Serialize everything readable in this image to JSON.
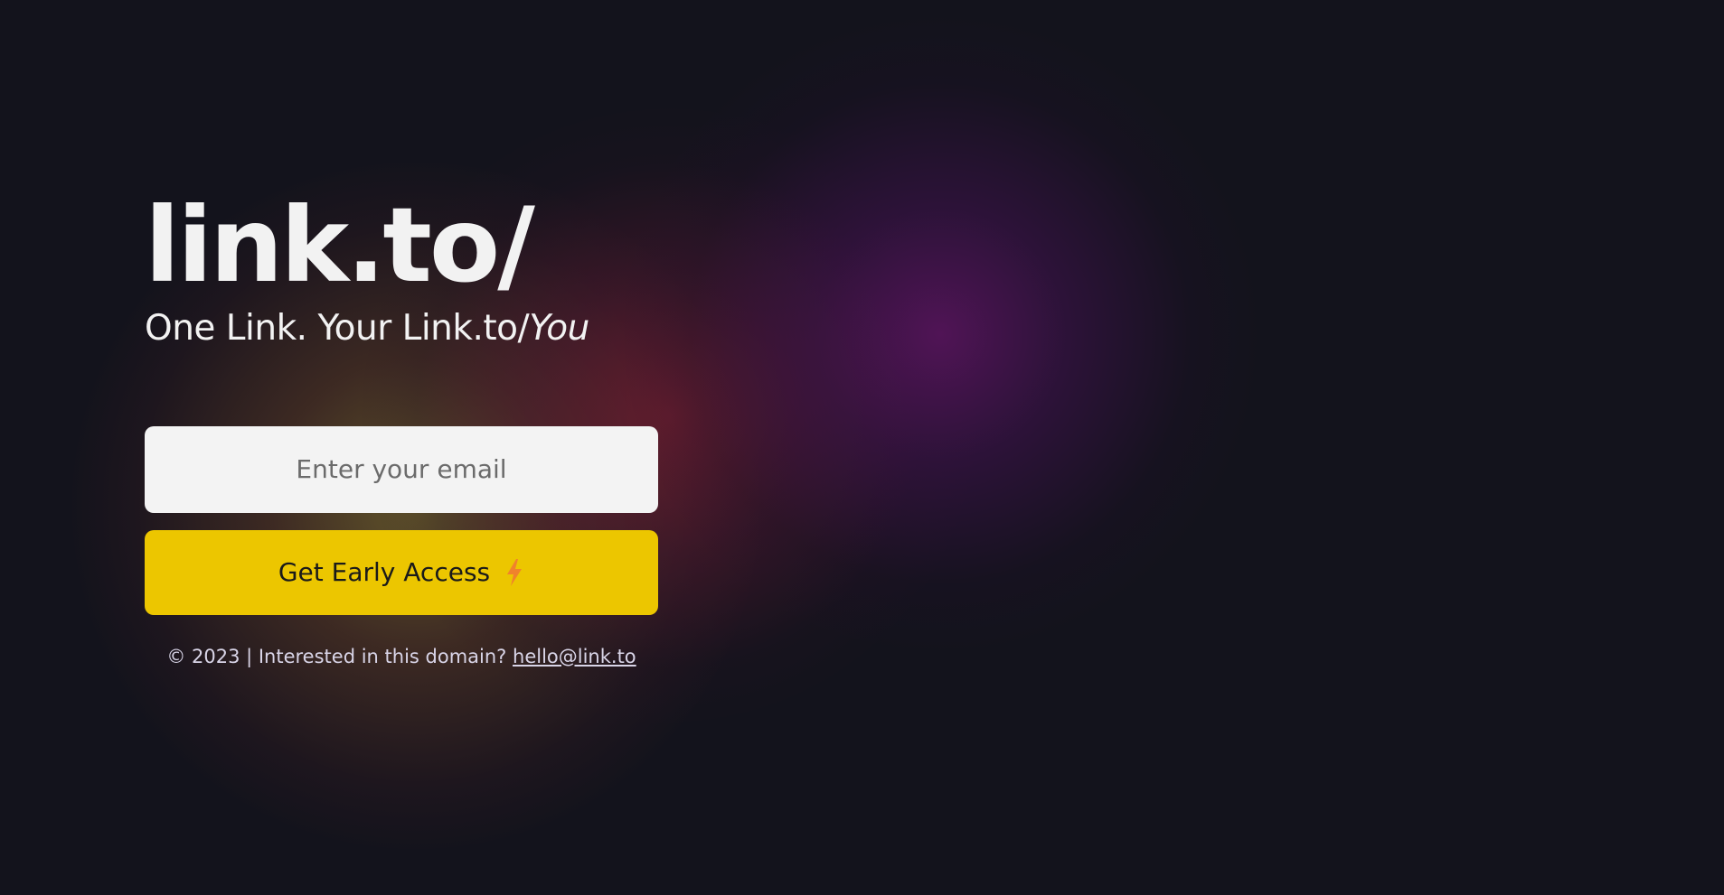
{
  "brand": {
    "logo": "link.to/",
    "tagline_prefix": "One Link. Your Link.to/",
    "tagline_emphasis": "You"
  },
  "signup": {
    "email_placeholder": "Enter your email",
    "email_value": "",
    "button_label": "Get Early Access",
    "button_icon": "lightning-bolt-icon"
  },
  "footer": {
    "text": "© 2023 | Interested in this domain?",
    "contact_email": "hello@link.to"
  },
  "colors": {
    "background": "#13131c",
    "button": "#ecc600",
    "input": "#f3f3f3",
    "bolt": "#f0822c",
    "glow_yellow": "#6e5f2d",
    "glow_red": "#781e32",
    "glow_purple": "#5f1464"
  }
}
